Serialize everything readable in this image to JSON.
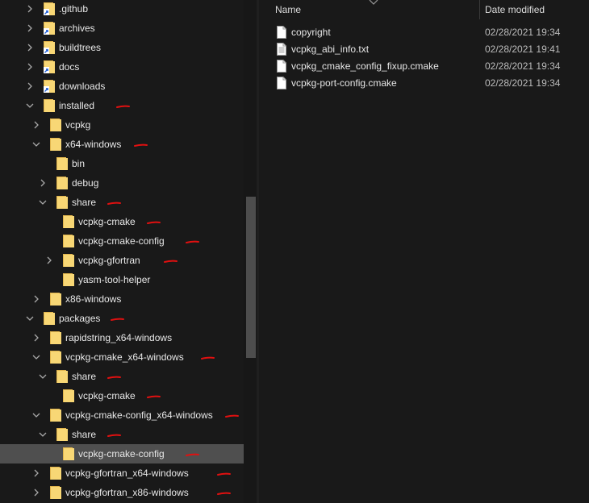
{
  "navigation_tree": [
    {
      "label": ".github",
      "depth": 0,
      "expander": "collapsed",
      "folder": "shortcut",
      "annotated": false,
      "selected": false
    },
    {
      "label": "archives",
      "depth": 0,
      "expander": "collapsed",
      "folder": "shortcut",
      "annotated": false,
      "selected": false
    },
    {
      "label": "buildtrees",
      "depth": 0,
      "expander": "collapsed",
      "folder": "shortcut",
      "annotated": false,
      "selected": false
    },
    {
      "label": "docs",
      "depth": 0,
      "expander": "collapsed",
      "folder": "shortcut",
      "annotated": false,
      "selected": false
    },
    {
      "label": "downloads",
      "depth": 0,
      "expander": "collapsed",
      "folder": "shortcut",
      "annotated": false,
      "selected": false
    },
    {
      "label": "installed",
      "depth": 0,
      "expander": "expanded",
      "folder": "plain",
      "annotated": true,
      "selected": false
    },
    {
      "label": "vcpkg",
      "depth": 1,
      "expander": "collapsed",
      "folder": "plain",
      "annotated": false,
      "selected": false
    },
    {
      "label": "x64-windows",
      "depth": 1,
      "expander": "expanded",
      "folder": "plain",
      "annotated": true,
      "selected": false
    },
    {
      "label": "bin",
      "depth": 2,
      "expander": "none",
      "folder": "plain",
      "annotated": false,
      "selected": false
    },
    {
      "label": "debug",
      "depth": 2,
      "expander": "collapsed",
      "folder": "plain",
      "annotated": false,
      "selected": false
    },
    {
      "label": "share",
      "depth": 2,
      "expander": "expanded",
      "folder": "plain",
      "annotated": true,
      "selected": false
    },
    {
      "label": "vcpkg-cmake",
      "depth": 3,
      "expander": "none",
      "folder": "plain",
      "annotated": true,
      "selected": false
    },
    {
      "label": "vcpkg-cmake-config",
      "depth": 3,
      "expander": "none",
      "folder": "plain",
      "annotated": true,
      "selected": false
    },
    {
      "label": "vcpkg-gfortran",
      "depth": 3,
      "expander": "collapsed",
      "folder": "plain",
      "annotated": true,
      "selected": false
    },
    {
      "label": "yasm-tool-helper",
      "depth": 3,
      "expander": "none",
      "folder": "plain",
      "annotated": false,
      "selected": false
    },
    {
      "label": "x86-windows",
      "depth": 1,
      "expander": "collapsed",
      "folder": "plain",
      "annotated": false,
      "selected": false
    },
    {
      "label": "packages",
      "depth": 0,
      "expander": "expanded",
      "folder": "plain",
      "annotated": true,
      "selected": false
    },
    {
      "label": "rapidstring_x64-windows",
      "depth": 1,
      "expander": "collapsed",
      "folder": "plain",
      "annotated": false,
      "selected": false
    },
    {
      "label": "vcpkg-cmake_x64-windows",
      "depth": 1,
      "expander": "expanded",
      "folder": "plain",
      "annotated": true,
      "selected": false
    },
    {
      "label": "share",
      "depth": 2,
      "expander": "expanded",
      "folder": "plain",
      "annotated": true,
      "selected": false
    },
    {
      "label": "vcpkg-cmake",
      "depth": 3,
      "expander": "none",
      "folder": "plain",
      "annotated": true,
      "selected": false
    },
    {
      "label": "vcpkg-cmake-config_x64-windows",
      "depth": 1,
      "expander": "expanded",
      "folder": "plain",
      "annotated": true,
      "selected": false
    },
    {
      "label": "share",
      "depth": 2,
      "expander": "expanded",
      "folder": "plain",
      "annotated": true,
      "selected": false
    },
    {
      "label": "vcpkg-cmake-config",
      "depth": 3,
      "expander": "none",
      "folder": "plain",
      "annotated": true,
      "selected": true
    },
    {
      "label": "vcpkg-gfortran_x64-windows",
      "depth": 1,
      "expander": "collapsed",
      "folder": "plain",
      "annotated": true,
      "selected": false
    },
    {
      "label": "vcpkg-gfortran_x86-windows",
      "depth": 1,
      "expander": "collapsed",
      "folder": "plain",
      "annotated": true,
      "selected": false
    }
  ],
  "file_list": {
    "columns": {
      "name": "Name",
      "date_modified": "Date modified"
    },
    "files": [
      {
        "name": "copyright",
        "date": "02/28/2021 19:34",
        "icon": "file-icon"
      },
      {
        "name": "vcpkg_abi_info.txt",
        "date": "02/28/2021 19:41",
        "icon": "text-file-icon"
      },
      {
        "name": "vcpkg_cmake_config_fixup.cmake",
        "date": "02/28/2021 19:34",
        "icon": "file-icon"
      },
      {
        "name": "vcpkg-port-config.cmake",
        "date": "02/28/2021 19:34",
        "icon": "file-icon"
      }
    ]
  },
  "colors": {
    "background": "#191919",
    "folder_fill": "#f8d775",
    "folder_tab": "#e0b44c",
    "annotation": "#e01010",
    "selected_row": "#4f4f4f",
    "scroll_thumb": "#4d4d4d"
  }
}
